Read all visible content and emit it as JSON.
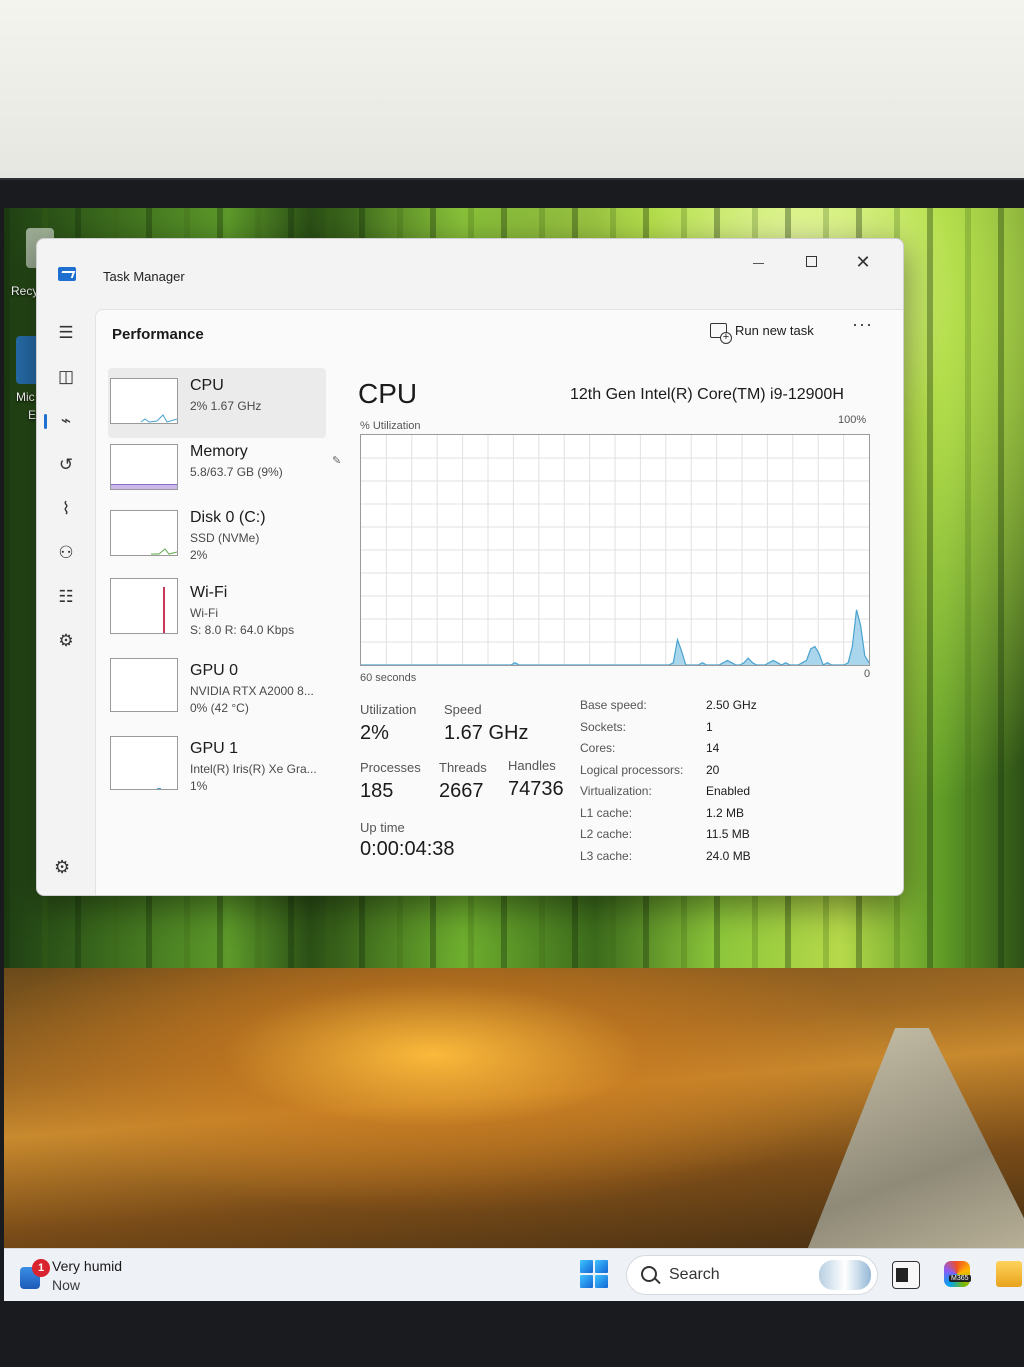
{
  "window": {
    "title": "Task Manager",
    "close_glyph": "✕"
  },
  "header": {
    "page_title": "Performance",
    "run_new_task": "Run new task",
    "more": "···"
  },
  "devices": [
    {
      "name": "CPU",
      "line2": "2% 1.67 GHz",
      "line3": ""
    },
    {
      "name": "Memory",
      "line2": "5.8/63.7 GB (9%)",
      "line3": ""
    },
    {
      "name": "Disk 0 (C:)",
      "line2": "SSD (NVMe)",
      "line3": "2%"
    },
    {
      "name": "Wi-Fi",
      "line2": "Wi-Fi",
      "line3": "S: 8.0 R: 64.0 Kbps"
    },
    {
      "name": "GPU 0",
      "line2": "NVIDIA RTX A2000 8...",
      "line3": "0% (42 °C)"
    },
    {
      "name": "GPU 1",
      "line2": "Intel(R) Iris(R) Xe Gra...",
      "line3": "1%"
    }
  ],
  "cpu": {
    "heading": "CPU",
    "model": "12th Gen Intel(R) Core(TM) i9-12900H",
    "graph_label": "% Utilization",
    "graph_max": "100%",
    "graph_min": "0",
    "graph_span": "60 seconds",
    "utilization_label": "Utilization",
    "utilization": "2%",
    "speed_label": "Speed",
    "speed": "1.67 GHz",
    "processes_label": "Processes",
    "processes": "185",
    "threads_label": "Threads",
    "threads": "2667",
    "handles_label": "Handles",
    "handles": "74736",
    "uptime_label": "Up time",
    "uptime": "0:00:04:38",
    "specs": [
      {
        "k": "Base speed:",
        "v": "2.50 GHz"
      },
      {
        "k": "Sockets:",
        "v": "1"
      },
      {
        "k": "Cores:",
        "v": "14"
      },
      {
        "k": "Logical processors:",
        "v": "20"
      },
      {
        "k": "Virtualization:",
        "v": "Enabled"
      },
      {
        "k": "L1 cache:",
        "v": "1.2 MB"
      },
      {
        "k": "L2 cache:",
        "v": "11.5 MB"
      },
      {
        "k": "L3 cache:",
        "v": "24.0 MB"
      }
    ],
    "history_percent": [
      0,
      0,
      0,
      0,
      0,
      0,
      0,
      0,
      0,
      0,
      0,
      0,
      0,
      0,
      0,
      0,
      0,
      0,
      0,
      0,
      0,
      0,
      0,
      0,
      0,
      0,
      0,
      0,
      0,
      0,
      0,
      0,
      0,
      0,
      0,
      0,
      0,
      1,
      0,
      0,
      0,
      0,
      0,
      0,
      0,
      0,
      0,
      0,
      0,
      0,
      0,
      0,
      0,
      0,
      0,
      0,
      0,
      0,
      0,
      0,
      0,
      0,
      0,
      0,
      0,
      0,
      0,
      0,
      0,
      0,
      0,
      0,
      0,
      0,
      0,
      1,
      11,
      6,
      0,
      0,
      0,
      0,
      1,
      0,
      0,
      0,
      0,
      1,
      2,
      1,
      0,
      0,
      1,
      3,
      1,
      0,
      0,
      0,
      1,
      2,
      1,
      0,
      1,
      0,
      0,
      0,
      1,
      2,
      7,
      8,
      5,
      0,
      1,
      0,
      0,
      0,
      0,
      1,
      8,
      24,
      17,
      4,
      1
    ],
    "colors": {
      "line": "#4aa3cf",
      "fill": "#a9d6ec",
      "grid": "#e1e1e1"
    }
  },
  "taskbar": {
    "weather_badge": "1",
    "weather_title": "Very humid",
    "weather_sub": "Now",
    "search": "Search",
    "m365_label": "M365"
  },
  "desktop": {
    "label1": "Recy",
    "label2": "Mic",
    "label3": "E"
  }
}
